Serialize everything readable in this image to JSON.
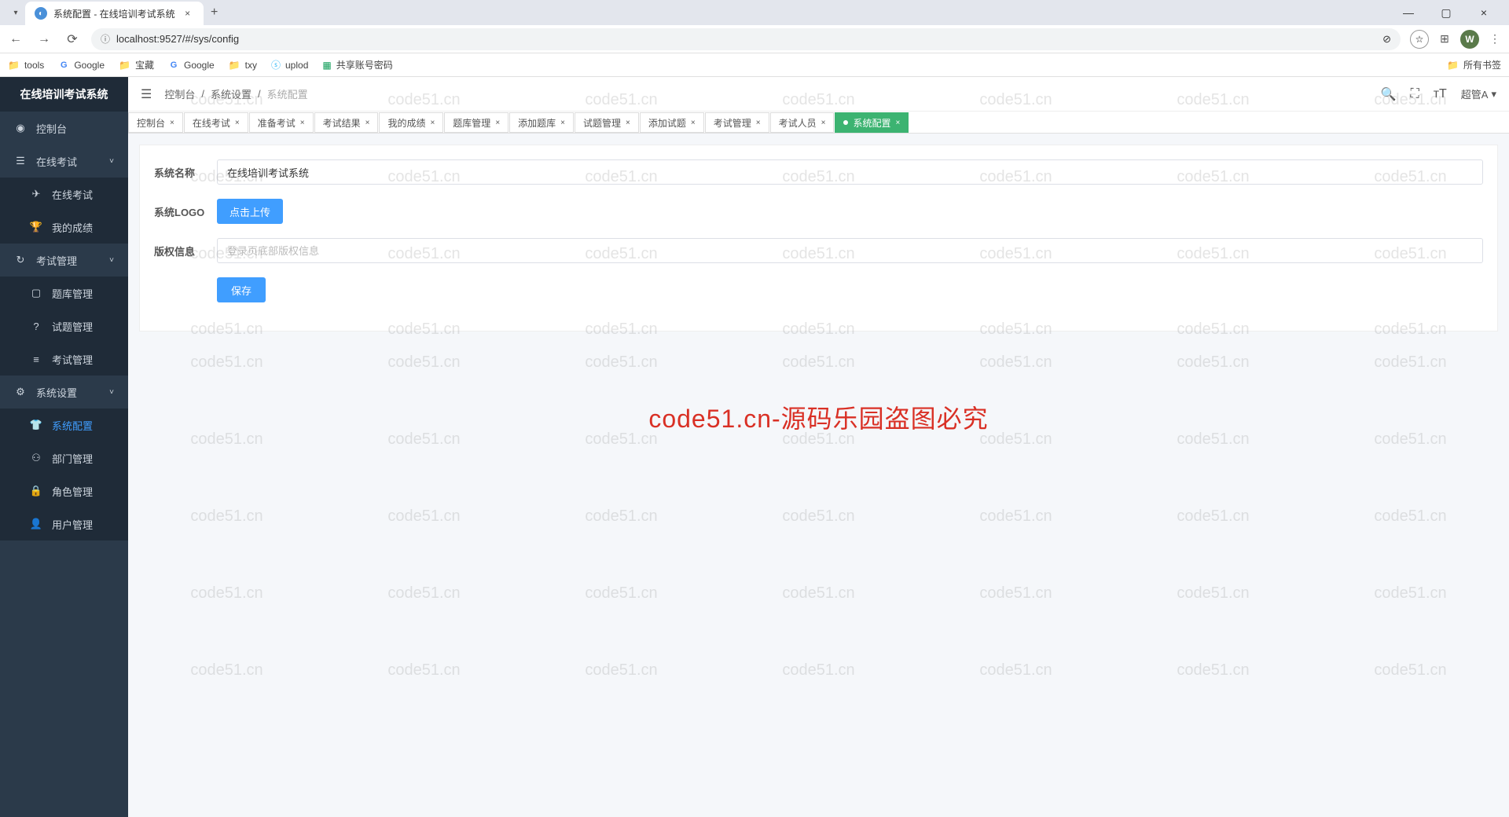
{
  "browser": {
    "tab_title": "系统配置 - 在线培训考试系统",
    "url": "localhost:9527/#/sys/config",
    "avatar_letter": "W",
    "bookmarks": [
      "tools",
      "Google",
      "宝藏",
      "Google",
      "txy",
      "uplod",
      "共享账号密码"
    ],
    "all_bookmarks": "所有书签"
  },
  "sidebar": {
    "logo": "在线培训考试系统",
    "items": [
      {
        "icon": "◉",
        "label": "控制台"
      },
      {
        "icon": "☰",
        "label": "在线考试",
        "arrow": "˅"
      },
      {
        "icon": "✈",
        "label": "在线考试",
        "sub": true
      },
      {
        "icon": "🏆",
        "label": "我的成绩",
        "sub": true
      },
      {
        "icon": "↻",
        "label": "考试管理",
        "arrow": "˅"
      },
      {
        "icon": "▢",
        "label": "题库管理",
        "sub": true
      },
      {
        "icon": "?",
        "label": "试题管理",
        "sub": true
      },
      {
        "icon": "≡",
        "label": "考试管理",
        "sub": true
      },
      {
        "icon": "⚙",
        "label": "系统设置",
        "arrow": "˅"
      },
      {
        "icon": "👕",
        "label": "系统配置",
        "sub": true,
        "active": true
      },
      {
        "icon": "⚇",
        "label": "部门管理",
        "sub": true
      },
      {
        "icon": "🔒",
        "label": "角色管理",
        "sub": true
      },
      {
        "icon": "👤",
        "label": "用户管理",
        "sub": true
      }
    ]
  },
  "topbar": {
    "breadcrumb": [
      "控制台",
      "系统设置",
      "系统配置"
    ],
    "user": "超管A"
  },
  "tabs": [
    {
      "label": "控制台"
    },
    {
      "label": "在线考试"
    },
    {
      "label": "准备考试"
    },
    {
      "label": "考试结果"
    },
    {
      "label": "我的成绩"
    },
    {
      "label": "题库管理"
    },
    {
      "label": "添加题库"
    },
    {
      "label": "试题管理"
    },
    {
      "label": "添加试题"
    },
    {
      "label": "考试管理"
    },
    {
      "label": "考试人员"
    },
    {
      "label": "系统配置",
      "active": true
    }
  ],
  "form": {
    "name_label": "系统名称",
    "name_value": "在线培训考试系统",
    "logo_label": "系统LOGO",
    "upload_btn": "点击上传",
    "copyright_label": "版权信息",
    "copyright_placeholder": "登录页底部版权信息",
    "save_btn": "保存"
  },
  "watermark": {
    "text": "code51.cn",
    "red_text": "code51.cn-源码乐园盗图必究"
  }
}
